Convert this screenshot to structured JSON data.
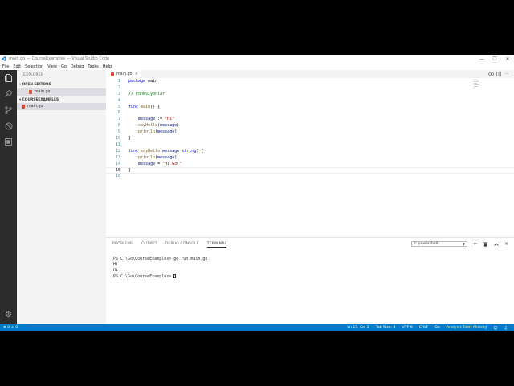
{
  "window": {
    "title": "main.go — CourseExamples — Visual Studio Code",
    "minimize": "—",
    "maximize": "☐",
    "close": "✕"
  },
  "menu": [
    "File",
    "Edit",
    "Selection",
    "View",
    "Go",
    "Debug",
    "Tasks",
    "Help"
  ],
  "sidebar": {
    "header": "EXPLORER",
    "open_editors_label": "▾ OPEN EDITORS",
    "open_editor_file": "main.go",
    "folder_label": "▾ COURSEEXAMPLES",
    "folder_file": "main.go"
  },
  "editor": {
    "tab_label": "main.go",
    "tab_close": "×",
    "code_lines": [
      {
        "n": "1",
        "parts": [
          [
            "kw",
            "package"
          ],
          [
            "",
            " main"
          ]
        ]
      },
      {
        "n": "2",
        "parts": []
      },
      {
        "n": "3",
        "parts": [
          [
            "cm",
            "// Fonksiyonlar"
          ]
        ]
      },
      {
        "n": "4",
        "parts": []
      },
      {
        "n": "5",
        "parts": [
          [
            "kw",
            "func"
          ],
          [
            "",
            " "
          ],
          [
            "fn",
            "main"
          ],
          [
            "",
            "() {"
          ]
        ]
      },
      {
        "n": "6",
        "parts": []
      },
      {
        "n": "7",
        "parts": [
          [
            "",
            "    "
          ],
          [
            "id",
            "message"
          ],
          [
            "",
            " := "
          ],
          [
            "str",
            "\"Hi\""
          ]
        ]
      },
      {
        "n": "8",
        "parts": [
          [
            "",
            "    "
          ],
          [
            "fn",
            "sayHello"
          ],
          [
            "",
            "("
          ],
          [
            "id",
            "message"
          ],
          [
            "",
            ")"
          ]
        ]
      },
      {
        "n": "9",
        "parts": [
          [
            "",
            "    "
          ],
          [
            "fn",
            "println"
          ],
          [
            "",
            "("
          ],
          [
            "id",
            "message"
          ],
          [
            "",
            ")"
          ]
        ]
      },
      {
        "n": "10",
        "parts": [
          [
            "",
            "}"
          ]
        ]
      },
      {
        "n": "11",
        "parts": []
      },
      {
        "n": "12",
        "parts": [
          [
            "kw",
            "func"
          ],
          [
            "",
            " "
          ],
          [
            "fn",
            "sayHello"
          ],
          [
            "",
            "("
          ],
          [
            "id",
            "message"
          ],
          [
            "",
            " "
          ],
          [
            "kw",
            "string"
          ],
          [
            "",
            ") {"
          ]
        ]
      },
      {
        "n": "13",
        "parts": [
          [
            "",
            "    "
          ],
          [
            "fn",
            "println"
          ],
          [
            "",
            "("
          ],
          [
            "id",
            "message"
          ],
          [
            "",
            ")"
          ]
        ]
      },
      {
        "n": "14",
        "parts": [
          [
            "",
            "    "
          ],
          [
            "id",
            "message"
          ],
          [
            "",
            " = "
          ],
          [
            "str",
            "\"Hi Go!\""
          ]
        ]
      },
      {
        "n": "15",
        "parts": [
          [
            "",
            "}"
          ]
        ]
      },
      {
        "n": "16",
        "parts": []
      }
    ],
    "active_line": "15"
  },
  "panel": {
    "tabs": [
      "PROBLEMS",
      "OUTPUT",
      "DEBUG CONSOLE",
      "TERMINAL"
    ],
    "active_tab": "TERMINAL",
    "terminal_select": "2: powershell",
    "terminal_lines": [
      "PS C:\\Go\\CourseExamples> go run main.go",
      "Hi",
      "Hi",
      "PS C:\\Go\\CourseExamples> "
    ]
  },
  "status": {
    "problems": "⊗ 0  ⚠ 0",
    "position": "Ln 15, Col 2",
    "tab_size": "Tab Size: 4",
    "encoding": "UTF-8",
    "eol": "CRLF",
    "language": "Go",
    "analysis": "Analysis Tools Missing",
    "smiley": "☺",
    "bell": "♫"
  },
  "colors": {
    "accent": "#007acc",
    "activity_bar": "#2c2c2c",
    "keyword": "#0000ff",
    "comment": "#008000",
    "string": "#a31515"
  }
}
